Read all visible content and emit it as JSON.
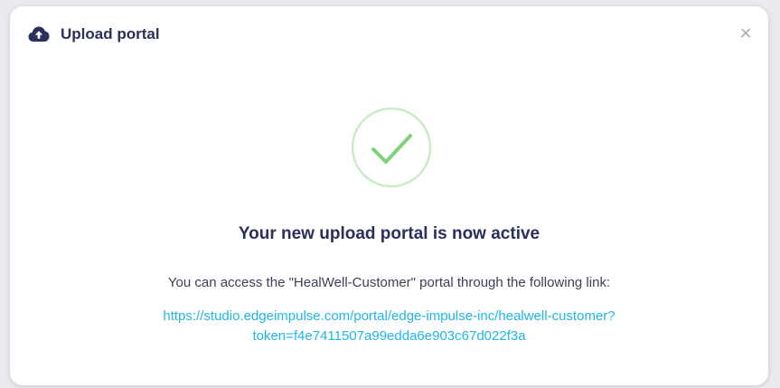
{
  "modal": {
    "title": "Upload portal",
    "header_icon": "cloud-upload-icon",
    "close_label": "×",
    "status_icon": "success-check-icon",
    "headline": "Your new upload portal is now active",
    "description": "You can access the \"HealWell-Customer\" portal through the following link:",
    "link_line1": "https://studio.edgeimpulse.com/portal/edge-impulse-inc/healwell-customer?",
    "link_line2": "token=f4e7411507a99edda6e903c67d022f3a",
    "link_href": "https://studio.edgeimpulse.com/portal/edge-impulse-inc/healwell-customer?token=f4e7411507a99edda6e903c67d022f3a"
  },
  "colors": {
    "title_text": "#2b2f5c",
    "link": "#1fb6e8",
    "success_green": "#7ed37a",
    "success_ring": "#c9ecc6"
  }
}
